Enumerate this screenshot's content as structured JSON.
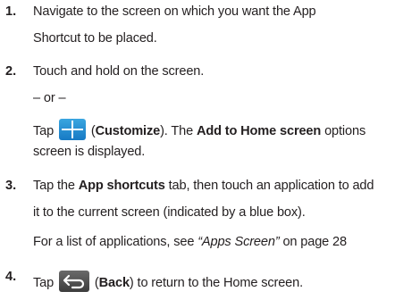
{
  "steps": [
    {
      "number": "1.",
      "lines": [
        "Navigate to the screen on which you want the App",
        "Shortcut to be placed."
      ]
    },
    {
      "number": "2.",
      "lines": [
        "Touch and hold on the screen."
      ],
      "or_text": "– or –",
      "tap_word": "Tap",
      "customize_label": "Customize",
      "after_customize": ". The",
      "add_to_home": "Add to Home screen",
      "options_text": "options",
      "line_end": "screen is displayed."
    },
    {
      "number": "3.",
      "tap_word": "Tap the",
      "app_shortcuts": "App shortcuts",
      "line1_rest": "tab, then touch an application to add",
      "line2": "it to the current screen (indicated by a blue box).",
      "list_text": "For a list of applications, see",
      "ref": "“Apps Screen”",
      "page_ref": "on page 28"
    },
    {
      "number": "4.",
      "tap_word": "Tap",
      "back_label": "Back",
      "rest": ") to return to the Home screen."
    }
  ],
  "icons": {
    "customize": "plus-icon",
    "back": "back-arrow-icon"
  },
  "colors": {
    "text": "#231f20",
    "customize_icon": "#1779c4",
    "back_icon": "#3c3c3c"
  }
}
